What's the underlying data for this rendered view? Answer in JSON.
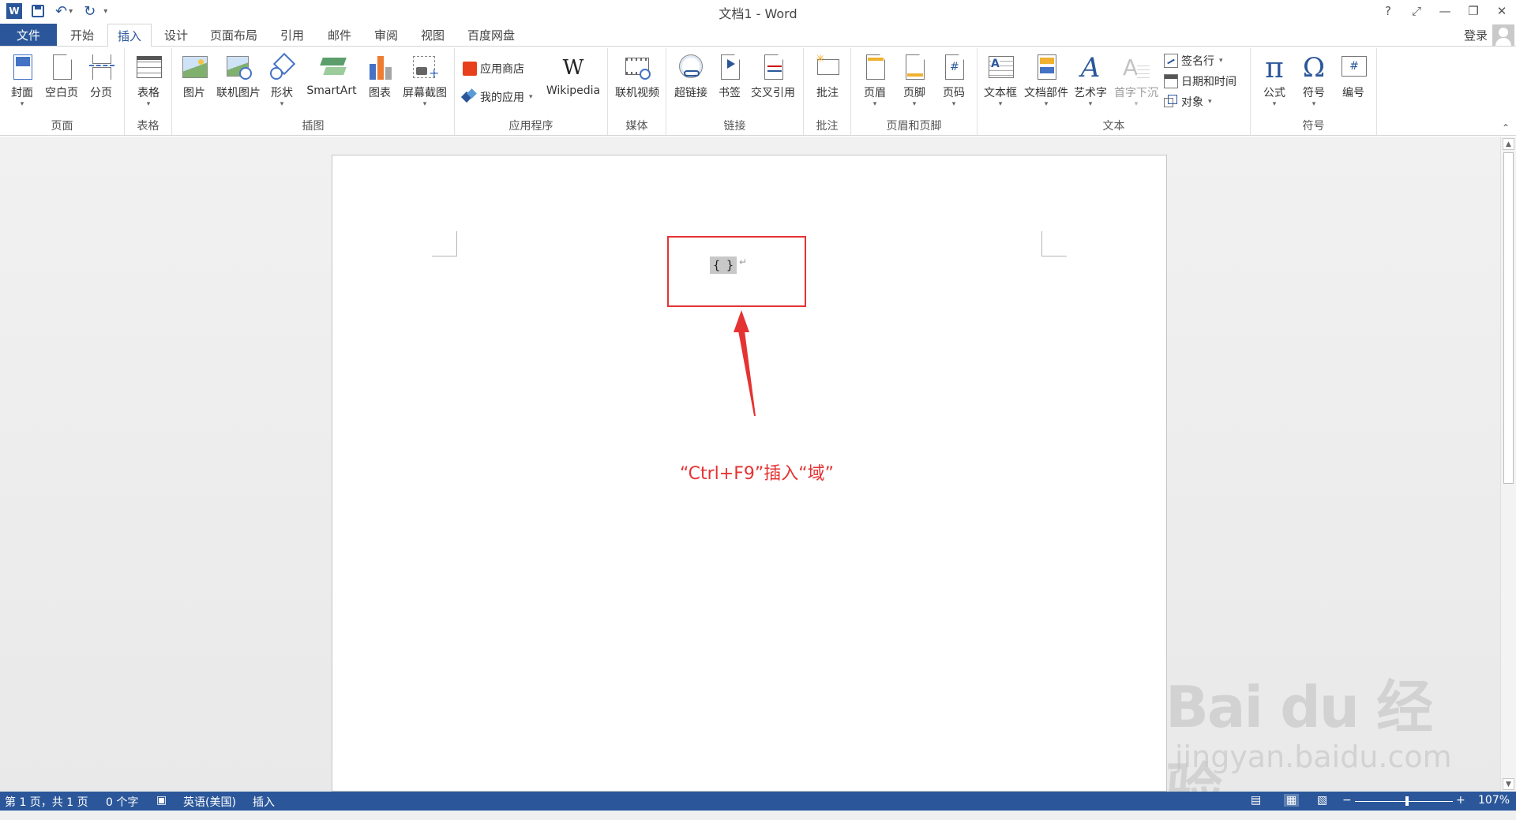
{
  "window": {
    "title": "文档1 - Word",
    "help": "?",
    "ribbon_display": "⤢",
    "minimize": "—",
    "restore": "❐",
    "close": "✕"
  },
  "quick_access": {
    "word_icon": "W",
    "save": "💾",
    "undo": "↶",
    "redo": "↻",
    "customize": "▾"
  },
  "tabs": {
    "file": "文件",
    "home": "开始",
    "insert": "插入",
    "design": "设计",
    "layout": "页面布局",
    "references": "引用",
    "mailings": "邮件",
    "review": "审阅",
    "view": "视图",
    "baidu": "百度网盘",
    "login": "登录"
  },
  "ribbon": {
    "pages": {
      "label": "页面",
      "cover": "封面",
      "blank": "空白页",
      "break": "分页"
    },
    "tables": {
      "label": "表格",
      "table": "表格"
    },
    "illustrations": {
      "label": "插图",
      "picture": "图片",
      "online_picture": "联机图片",
      "shapes": "形状",
      "smartart": "SmartArt",
      "chart": "图表",
      "screenshot": "屏幕截图"
    },
    "apps": {
      "label": "应用程序",
      "store": "应用商店",
      "my_apps": "我的应用",
      "wikipedia": "Wikipedia",
      "wiki_glyph": "W"
    },
    "media": {
      "label": "媒体",
      "online_video": "联机视频"
    },
    "links": {
      "label": "链接",
      "hyperlink": "超链接",
      "bookmark": "书签",
      "cross_ref": "交叉引用"
    },
    "comments": {
      "label": "批注",
      "comment": "批注"
    },
    "header_footer": {
      "label": "页眉和页脚",
      "header": "页眉",
      "footer": "页脚",
      "page_number": "页码"
    },
    "text": {
      "label": "文本",
      "textbox": "文本框",
      "quick_parts": "文档部件",
      "wordart": "艺术字",
      "dropcap": "首字下沉",
      "signature": "签名行",
      "datetime": "日期和时间",
      "object": "对象"
    },
    "symbols": {
      "label": "符号",
      "equation": "公式",
      "symbol": "符号",
      "numbering": "编号",
      "pi": "π",
      "omega": "Ω",
      "hash": "#"
    },
    "collapse": "⌃"
  },
  "document": {
    "field_open": "{",
    "field_close": "}",
    "para_mark": "↵",
    "annotation": "“Ctrl+F9”插入“域”"
  },
  "watermark": {
    "main": "Bai du 经验",
    "sub": "jingyan.baidu.com"
  },
  "status": {
    "page": "第 1 页，共 1 页",
    "words": "0 个字",
    "language": "英语(美国)",
    "mode": "插入",
    "zoom": "107%",
    "zoom_minus": "−",
    "zoom_plus": "+"
  },
  "colors": {
    "accent": "#2b579a",
    "annotation": "#e53333"
  }
}
